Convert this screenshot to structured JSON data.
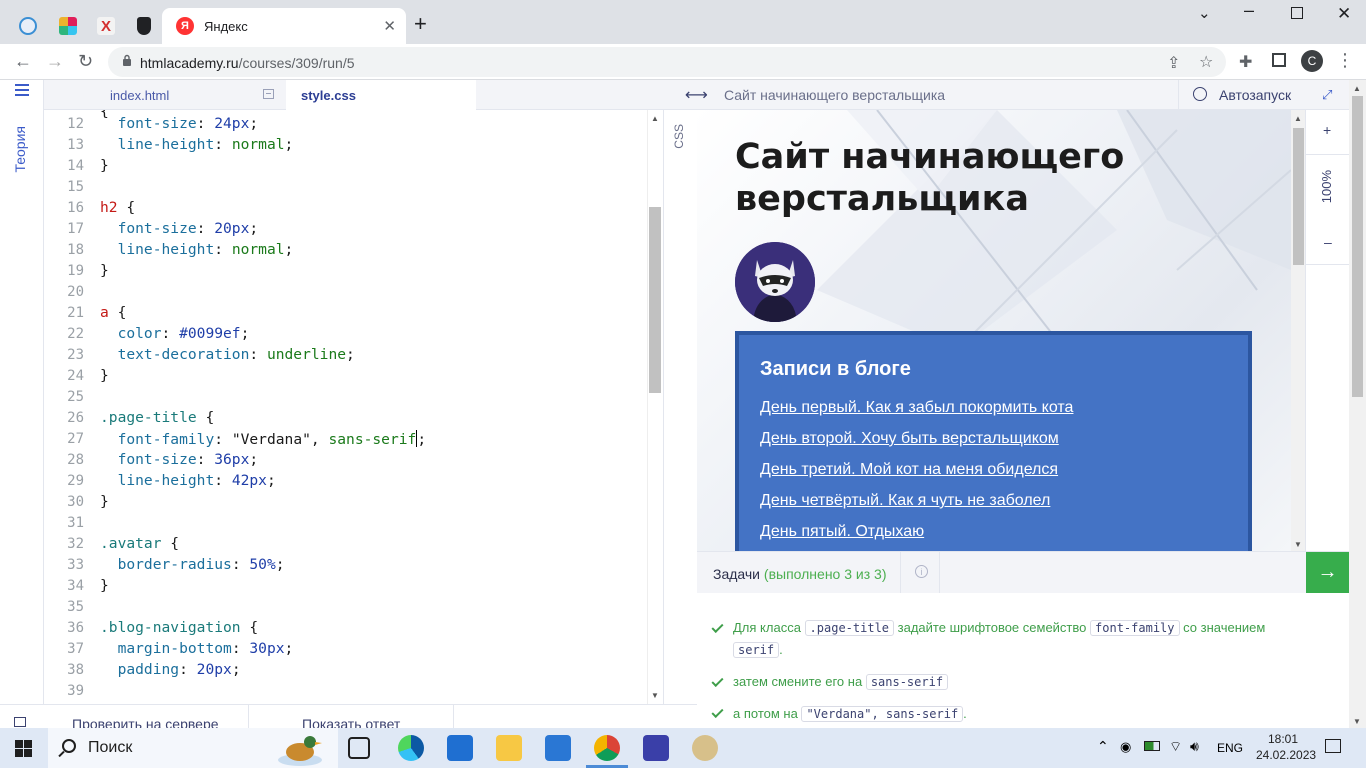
{
  "browser": {
    "tabs": [
      {
        "favicon": "htmlacademy-icon"
      },
      {
        "favicon": "slack-icon"
      },
      {
        "favicon": "red-app-icon"
      },
      {
        "favicon": "shield-icon"
      },
      {
        "favicon": "yandex-icon",
        "title": "Яндекс",
        "active": true
      }
    ],
    "url_host": "htmlacademy.ru",
    "url_path": "/courses/309/run/5",
    "profile_initial": "C"
  },
  "sidebar": {
    "theory_label": "Теория"
  },
  "editor": {
    "tabs": [
      {
        "label": "index.html"
      },
      {
        "label": "style.css",
        "active": true
      }
    ],
    "side_label": "CSS",
    "line_numbers": [
      "12",
      "13",
      "14",
      "15",
      "16",
      "17",
      "18",
      "19",
      "20",
      "21",
      "22",
      "23",
      "24",
      "25",
      "26",
      "27",
      "28",
      "29",
      "30",
      "31",
      "32",
      "33",
      "34",
      "35",
      "36",
      "37",
      "38",
      "39"
    ],
    "footer": {
      "check_label": "Проверить на сервере",
      "answer_label": "Показать ответ"
    }
  },
  "preview": {
    "title": "Сайт начинающего верстальщика",
    "autorun_label": "Автозапуск",
    "zoom": "100%",
    "zoom_in": "+",
    "zoom_out": "–",
    "page": {
      "heading": "Сайт начинающего верстальщика",
      "blog_title": "Записи в блоге",
      "links": [
        "День первый. Как я забыл покормить кота",
        "День второй. Хочу быть верстальщиком",
        "День третий. Мой кот на меня обиделся",
        "День четвёртый. Как я чуть не заболел",
        "День пятый. Отдыхаю"
      ]
    }
  },
  "tasks": {
    "label": "Задачи",
    "progress": "(выполнено 3 из 3)",
    "items": [
      {
        "pre": "Для класса",
        "code1": ".page-title",
        "mid": "задайте шрифтовое семейство",
        "code2": "font-family",
        "post": "со значением",
        "code3": "serif",
        "end": "."
      },
      {
        "pre": "затем смените его на",
        "code1": "sans-serif"
      },
      {
        "pre": "а потом на",
        "code1": "\"Verdana\", sans-serif",
        "end": "."
      }
    ]
  },
  "taskbar": {
    "search_placeholder": "Поиск",
    "lang": "ENG",
    "time": "18:01",
    "date": "24.02.2023"
  },
  "colors": {
    "accent": "#3b5bc9",
    "success": "#37ad4c",
    "blog_bg": "#4473c5"
  }
}
